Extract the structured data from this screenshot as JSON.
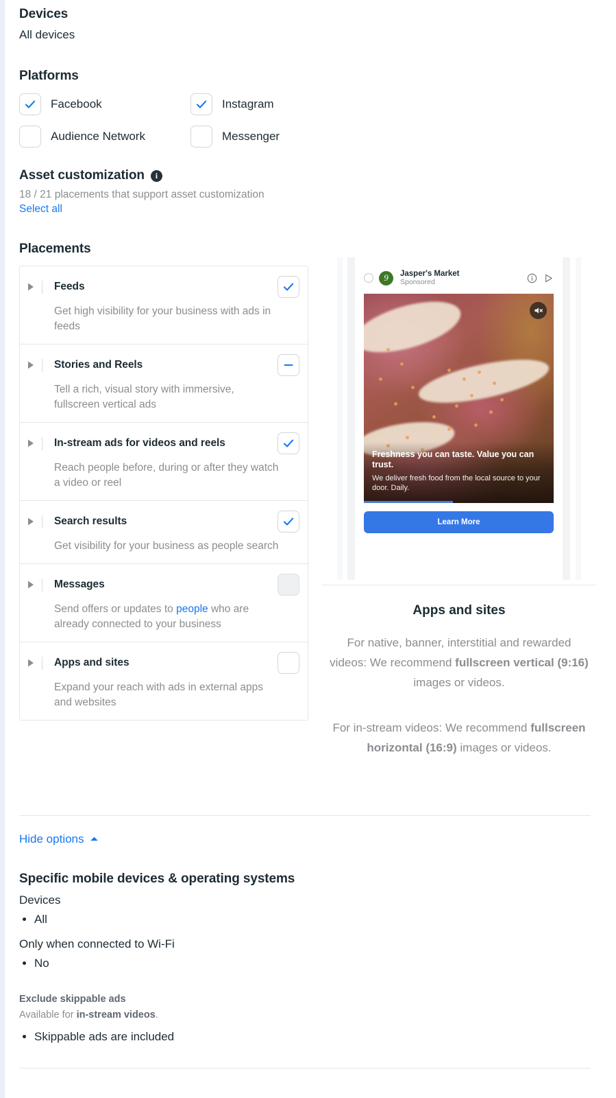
{
  "devices": {
    "heading": "Devices",
    "value": "All devices"
  },
  "platforms": {
    "heading": "Platforms",
    "items": [
      {
        "label": "Facebook",
        "checked": true
      },
      {
        "label": "Instagram",
        "checked": true
      },
      {
        "label": "Audience Network",
        "checked": false
      },
      {
        "label": "Messenger",
        "checked": false
      }
    ]
  },
  "asset_customization": {
    "heading": "Asset customization",
    "info_icon": "info-icon",
    "count_text": "18 / 21 placements that support asset customization",
    "select_all_label": "Select all"
  },
  "placements": {
    "heading": "Placements",
    "items": [
      {
        "title": "Feeds",
        "description": "Get high visibility for your business with ads in feeds",
        "state": "checked"
      },
      {
        "title": "Stories and Reels",
        "description": "Tell a rich, visual story with immersive, fullscreen vertical ads",
        "state": "indeterminate"
      },
      {
        "title": "In-stream ads for videos and reels",
        "description": "Reach people before, during or after they watch a video or reel",
        "state": "checked"
      },
      {
        "title": "Search results",
        "description": "Get visibility for your business as people search",
        "state": "checked"
      },
      {
        "title": "Messages",
        "description_pre": "Send offers or updates to ",
        "description_link": "people",
        "description_post": " who are already connected to your business",
        "state": "disabled"
      },
      {
        "title": "Apps and sites",
        "description": "Expand your reach with ads in external apps and websites",
        "state": "unchecked"
      }
    ]
  },
  "preview": {
    "ad": {
      "brand": "Jasper's Market",
      "sponsored": "Sponsored",
      "overlay_title": "Freshness you can taste. Value you can trust.",
      "overlay_subtitle": "We deliver fresh food from the local source to your door. Daily.",
      "cta_label": "Learn More"
    },
    "title": "Apps and sites",
    "paragraph1_pre": "For native, banner, interstitial and rewarded videos: We recommend ",
    "paragraph1_bold": "fullscreen vertical (9:16)",
    "paragraph1_post": " images or videos.",
    "paragraph2_pre": "For in-stream videos: We recommend ",
    "paragraph2_bold": "fullscreen horizontal (16:9)",
    "paragraph2_post": " images or videos."
  },
  "options": {
    "hide_options_label": "Hide options",
    "specific_heading": "Specific mobile devices & operating systems",
    "devices_label": "Devices",
    "devices_values": [
      "All"
    ],
    "wifi_label": "Only when connected to Wi-Fi",
    "wifi_values": [
      "No"
    ],
    "exclude_heading": "Exclude skippable ads",
    "exclude_available_pre": "Available for ",
    "exclude_available_bold": "in-stream videos",
    "exclude_available_post": ".",
    "exclude_values": [
      "Skippable ads are included"
    ]
  },
  "colors": {
    "accent_blue": "#1877f2",
    "cta_blue": "#3578e5",
    "text_dark": "#1c2b33",
    "text_muted": "#8a8d91",
    "border": "#e4e6eb",
    "brand_green": "#3e7827"
  }
}
